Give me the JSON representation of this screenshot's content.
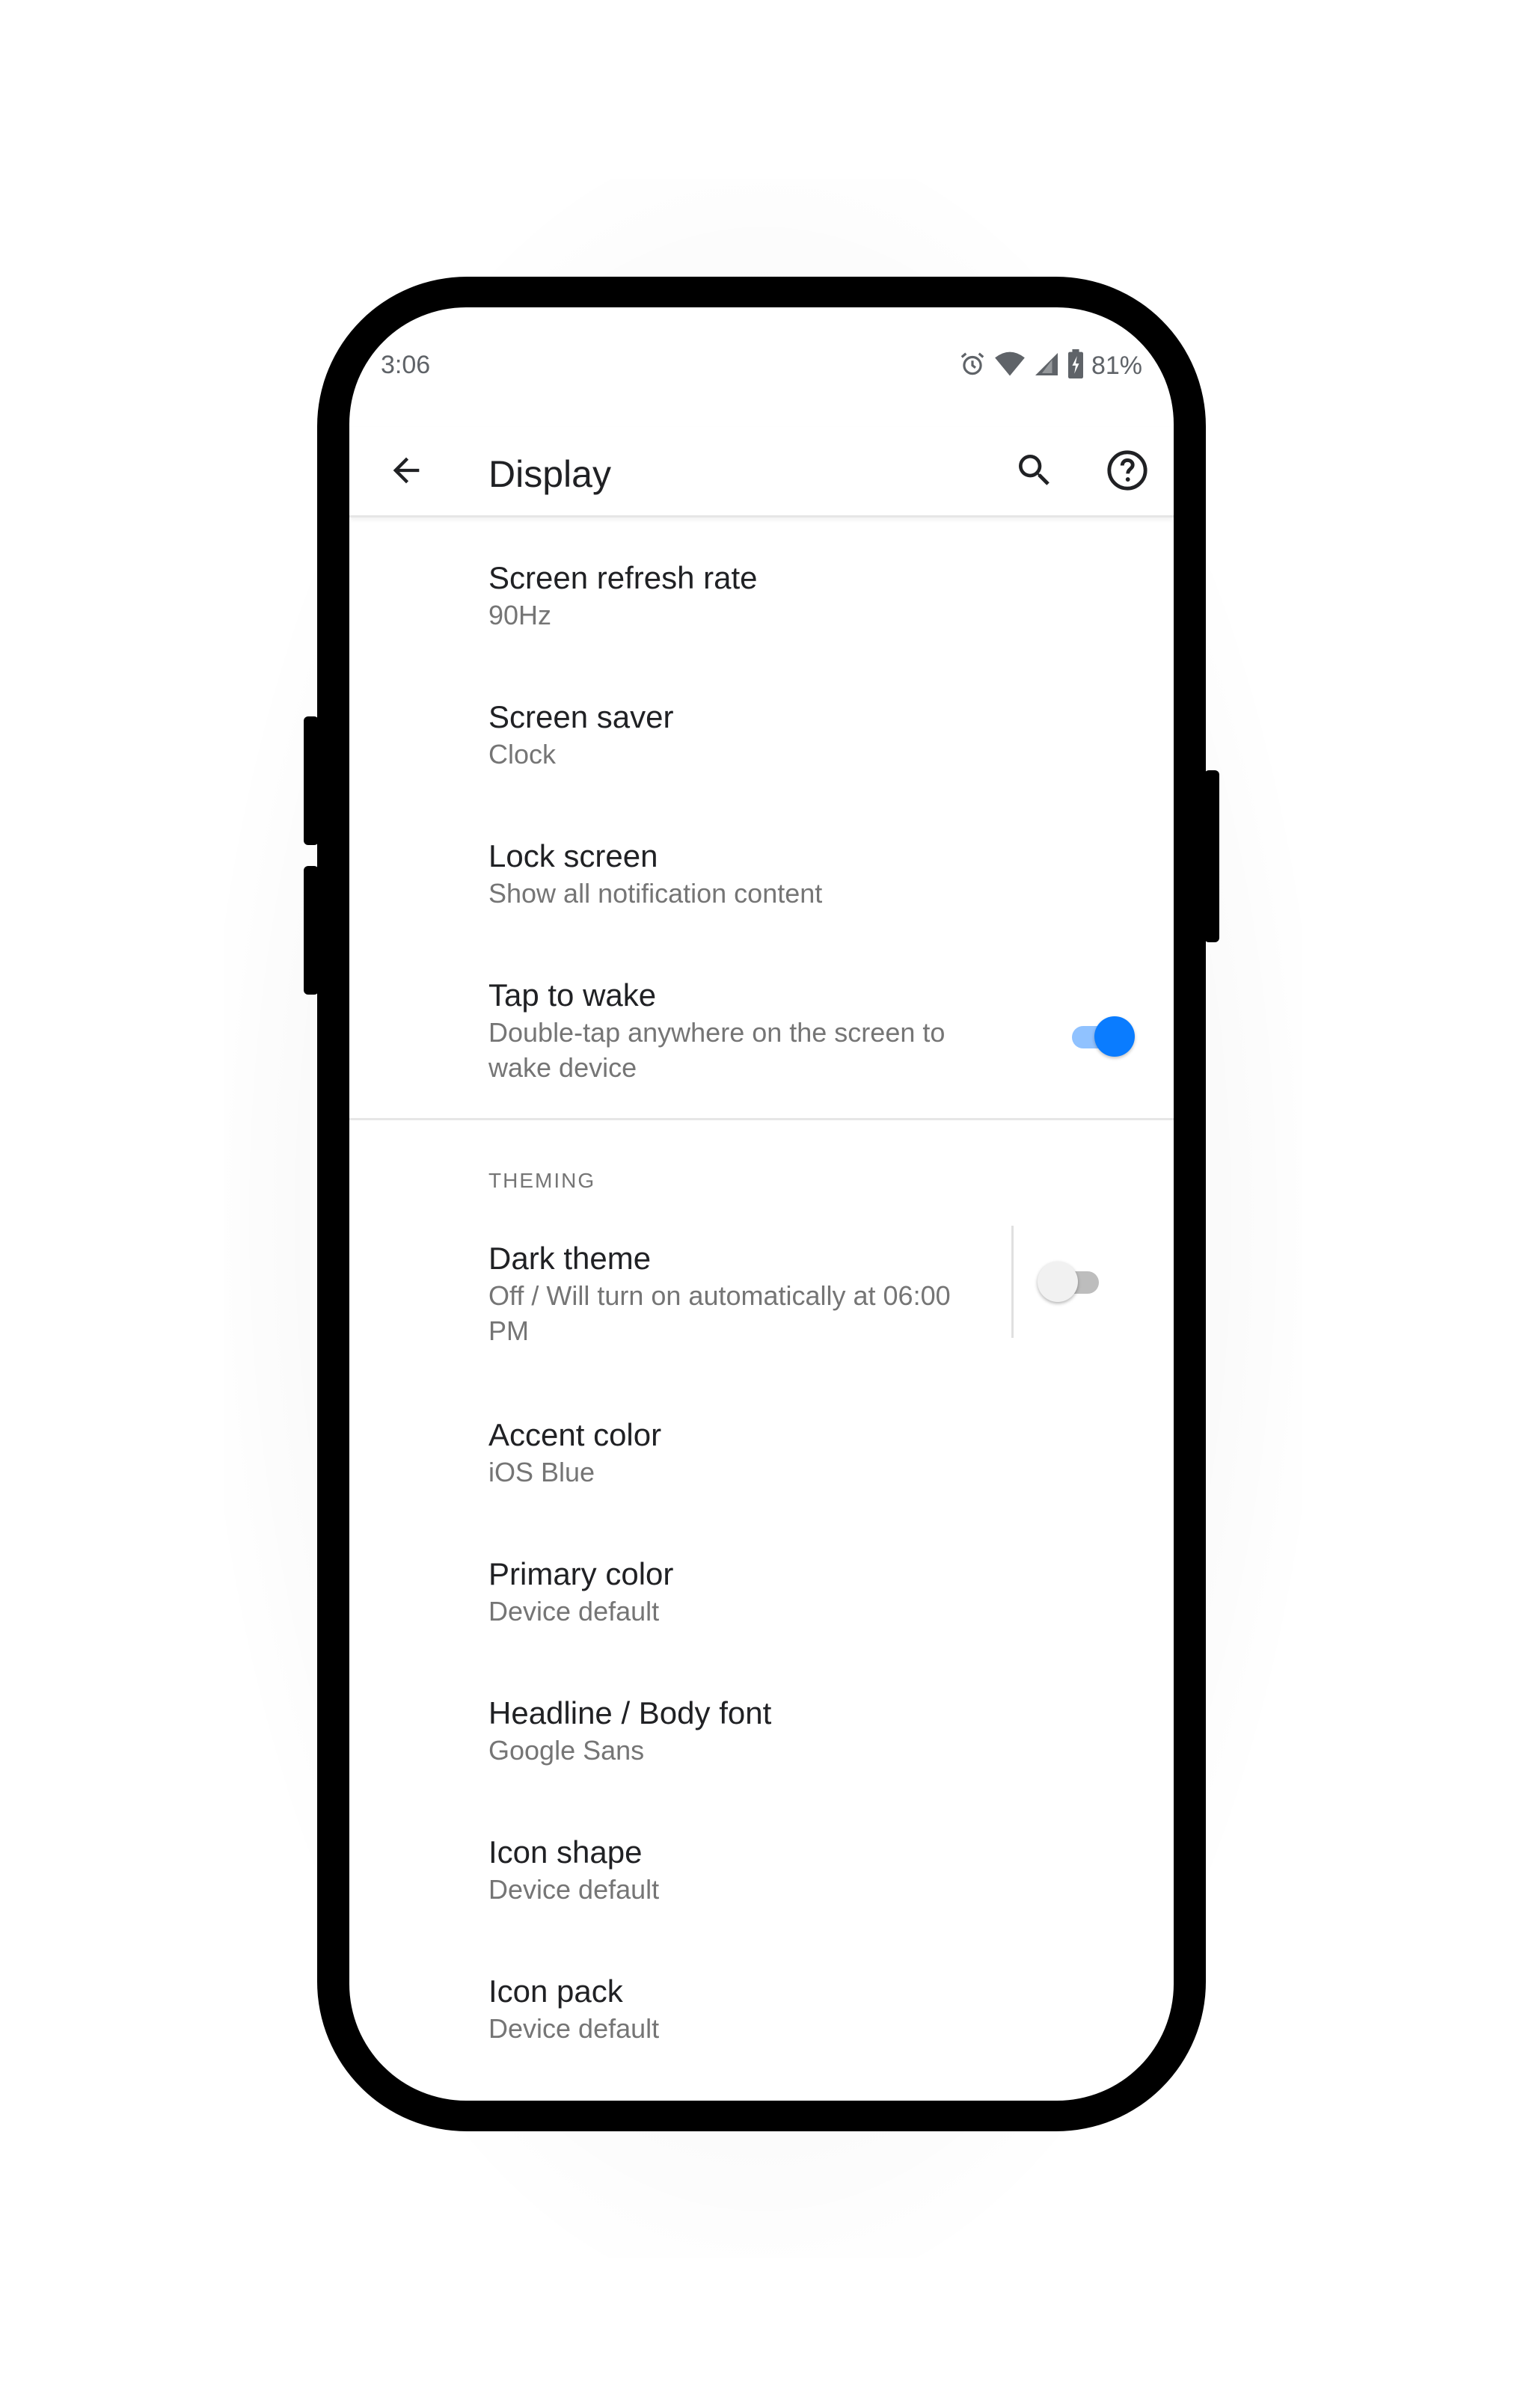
{
  "status_bar": {
    "time": "3:06",
    "battery_percent": "81%",
    "icons": [
      "alarm-icon",
      "wifi-icon",
      "signal-icon",
      "battery-icon"
    ]
  },
  "toolbar": {
    "title": "Display",
    "back_icon": "arrow-back-icon",
    "search_icon": "search-icon",
    "help_icon": "help-icon"
  },
  "preferences": {
    "refresh_rate": {
      "title": "Screen refresh rate",
      "summary": "90Hz"
    },
    "screen_saver": {
      "title": "Screen saver",
      "summary": "Clock"
    },
    "lock_screen": {
      "title": "Lock screen",
      "summary": "Show all notification content"
    },
    "tap_to_wake": {
      "title": "Tap to wake",
      "summary_line1": "Double-tap anywhere on the screen to",
      "summary_line2": "wake device",
      "enabled": true
    },
    "theming_header": "THEMING",
    "dark_theme": {
      "title": "Dark theme",
      "summary_line1": "Off / Will turn on automatically at 06:00",
      "summary_line2": "PM",
      "enabled": false
    },
    "accent_color": {
      "title": "Accent color",
      "summary": "iOS Blue"
    },
    "primary_color": {
      "title": "Primary color",
      "summary": "Device default"
    },
    "font": {
      "title": "Headline / Body font",
      "summary": "Google Sans"
    },
    "icon_shape": {
      "title": "Icon shape",
      "summary": "Device default"
    },
    "icon_pack": {
      "title": "Icon pack",
      "summary": "Device default"
    }
  },
  "colors": {
    "accent": "#0a7cff",
    "accent_track": "#90c2ff",
    "text_primary": "#202124",
    "text_secondary": "#757575"
  }
}
